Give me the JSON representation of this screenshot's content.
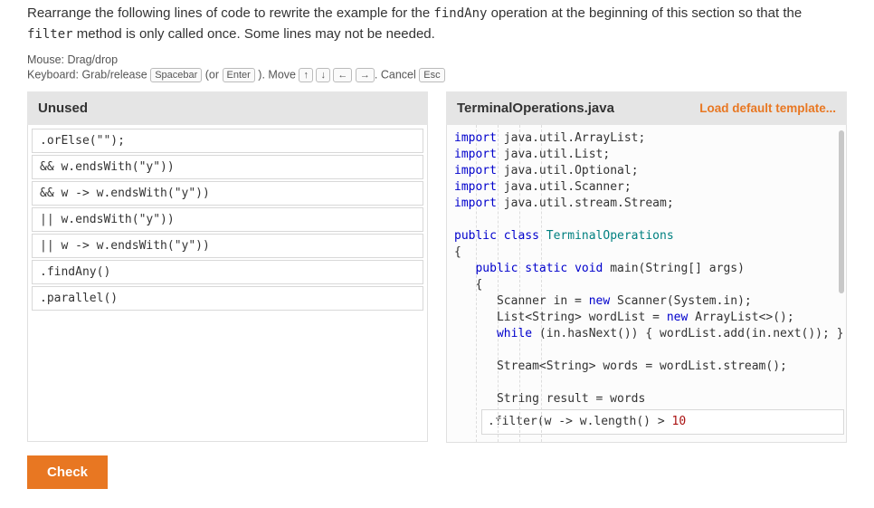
{
  "instructions": {
    "part1": "Rearrange the following lines of code to rewrite the example for the ",
    "code1": "findAny",
    "part2": " operation at the beginning of this section so that the ",
    "code2": "filter",
    "part3": " method is only called once. Some lines may not be needed."
  },
  "hints": {
    "mouse": "Mouse: Drag/drop",
    "kb_prefix": "Keyboard: Grab/release ",
    "spacebar": "Spacebar",
    "or": " (or ",
    "enter": "Enter",
    "close_paren": " ). Move ",
    "up": "↑",
    "down": "↓",
    "left": "←",
    "right": "→",
    "cancel_prefix": ". Cancel ",
    "esc": "Esc"
  },
  "left_panel": {
    "title": "Unused",
    "items": [
      ".orElse(\"\");",
      "&& w.endsWith(\"y\"))",
      "&& w -> w.endsWith(\"y\"))",
      "|| w.endsWith(\"y\"))",
      "|| w -> w.endsWith(\"y\"))",
      ".findAny()",
      ".parallel()"
    ]
  },
  "right_panel": {
    "title": "TerminalOperations.java",
    "load_link": "Load default template...",
    "imports": [
      {
        "pkg": "java.util.ArrayList"
      },
      {
        "pkg": "java.util.List"
      },
      {
        "pkg": "java.util.Optional"
      },
      {
        "pkg": "java.util.Scanner"
      },
      {
        "pkg": "java.util.stream.Stream"
      }
    ],
    "class_decl_kw1": "public",
    "class_decl_kw2": "class",
    "class_name": "TerminalOperations",
    "open_brace": "{",
    "main_sig_pre": "   ",
    "main_kw1": "public",
    "main_kw2": "static",
    "main_kw3": "void",
    "main_name": " main(String[] args)",
    "main_open": "   {",
    "line_scanner_pre": "      Scanner in = ",
    "kw_new": "new",
    "line_scanner_post": " Scanner(System.in);",
    "line_list_pre": "      List<String> wordList = ",
    "line_list_post": " ArrayList<>();",
    "line_while_pre": "      ",
    "kw_while": "while",
    "line_while_post": " (in.hasNext()) { wordList.add(in.next()); }",
    "line_stream": "      Stream<String> words = wordList.stream();",
    "line_result": "      String result = words",
    "slot_filter_pre": ".filter(w -> w.length() > ",
    "slot_filter_num": "10",
    "slot_filter_post": ""
  },
  "check_label": "Check"
}
